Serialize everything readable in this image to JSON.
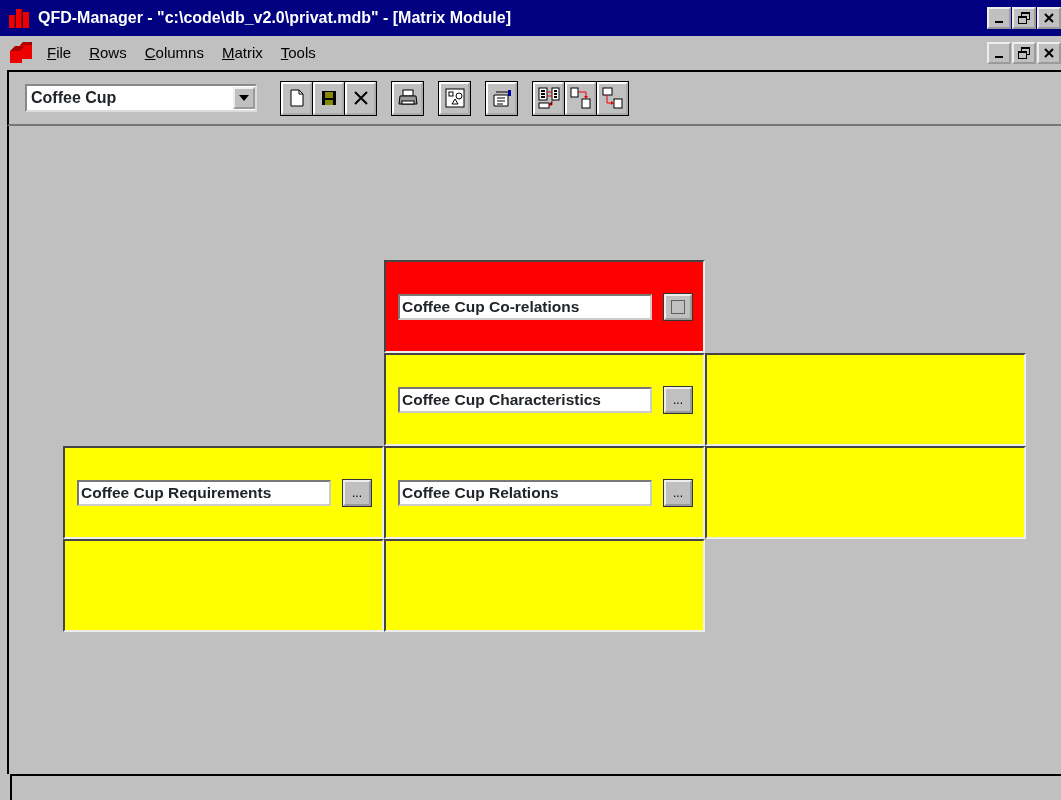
{
  "window": {
    "title": "QFD-Manager - \"c:\\code\\db_v2.0\\privat.mdb\" - [Matrix Module]"
  },
  "menu": [
    {
      "label": "File"
    },
    {
      "label": "Rows"
    },
    {
      "label": "Columns"
    },
    {
      "label": "Matrix"
    },
    {
      "label": "Tools"
    }
  ],
  "toolbar": {
    "combo": {
      "value": "Coffee Cup"
    }
  },
  "matrix": [
    [
      {
        "kind": "blank"
      },
      {
        "kind": "panel",
        "color": "#ff0000",
        "label": "Coffee Cup Co-relations",
        "button": {
          "kind": "icon"
        }
      },
      {
        "kind": "blank"
      }
    ],
    [
      {
        "kind": "blank"
      },
      {
        "kind": "panel",
        "color": "#ffff00",
        "label": "Coffee Cup Characteristics",
        "button": {
          "kind": "text",
          "label": "..."
        }
      },
      {
        "kind": "panel",
        "color": "#ffff00"
      }
    ],
    [
      {
        "kind": "panel",
        "color": "#ffff00",
        "label": "Coffee Cup Requirements",
        "button": {
          "kind": "text",
          "label": "..."
        }
      },
      {
        "kind": "panel",
        "color": "#ffff00",
        "label": "Coffee Cup Relations",
        "button": {
          "kind": "text",
          "label": "..."
        }
      },
      {
        "kind": "panel",
        "color": "#ffff00"
      }
    ],
    [
      {
        "kind": "panel",
        "color": "#ffff00"
      },
      {
        "kind": "panel",
        "color": "#ffff00"
      },
      {
        "kind": "blank"
      }
    ]
  ]
}
